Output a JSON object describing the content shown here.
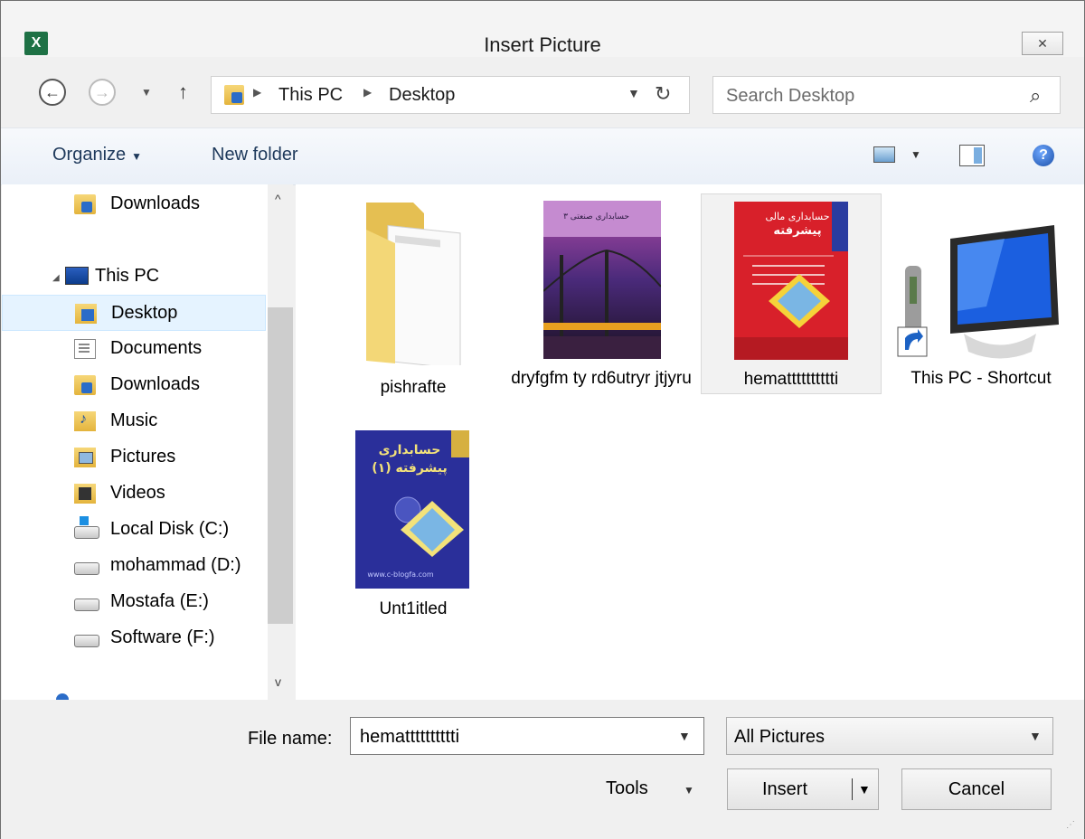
{
  "window": {
    "title": "Insert Picture",
    "app_icon": "excel-icon",
    "close_glyph": "✕"
  },
  "address": {
    "segments": [
      "This PC",
      "Desktop"
    ],
    "search_placeholder": "Search Desktop"
  },
  "toolbar": {
    "organize": "Organize",
    "new_folder": "New folder"
  },
  "nav": {
    "items": [
      {
        "label": "Downloads",
        "icon": "downloads-folder-icon"
      },
      {
        "label": "This PC",
        "icon": "this-pc-icon"
      },
      {
        "label": "Desktop",
        "icon": "desktop-folder-icon",
        "selected": true
      },
      {
        "label": "Documents",
        "icon": "documents-icon"
      },
      {
        "label": "Downloads",
        "icon": "downloads-folder-icon"
      },
      {
        "label": "Music",
        "icon": "music-folder-icon"
      },
      {
        "label": "Pictures",
        "icon": "pictures-folder-icon"
      },
      {
        "label": "Videos",
        "icon": "videos-folder-icon"
      },
      {
        "label": "Local Disk (C:)",
        "icon": "windows-drive-icon"
      },
      {
        "label": "mohammad (D:)",
        "icon": "drive-icon"
      },
      {
        "label": "Mostafa (E:)",
        "icon": "drive-icon"
      },
      {
        "label": "Software (F:)",
        "icon": "drive-icon"
      }
    ]
  },
  "files": [
    {
      "name": "pishrafte",
      "type": "folder"
    },
    {
      "name": "dryfgfm ty rd6utryr jtjyru",
      "type": "image"
    },
    {
      "name": "hematttttttttti",
      "type": "image",
      "selected": true
    },
    {
      "name": "This PC - Shortcut",
      "type": "shortcut"
    },
    {
      "name": "Unt1itled",
      "type": "image"
    }
  ],
  "thumb_text": {
    "dryfgfm": "حسابداری صنعتی ۳",
    "hemat_1": "حسابداری مالی",
    "hemat_2": "پیشرفته",
    "untitled_1": "حسابداری",
    "untitled_2": "پیشرفته (۱)",
    "untitled_3": "www.c-blogfa.com"
  },
  "footer": {
    "file_name_label": "File name:",
    "file_name_value": "hematttttttttti",
    "file_type": "All Pictures",
    "tools_label": "Tools",
    "insert_label": "Insert",
    "cancel_label": "Cancel"
  },
  "colors": {
    "selection_bg": "#e5f3ff",
    "toolbar_text": "#1e395b",
    "excel_green": "#1e7145"
  }
}
